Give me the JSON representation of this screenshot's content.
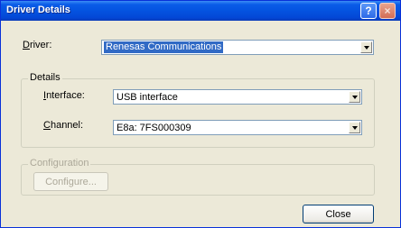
{
  "window": {
    "title": "Driver Details"
  },
  "titlebar_buttons": {
    "help": "?",
    "close": "×"
  },
  "driver": {
    "label_accel": "D",
    "label_rest": "river:",
    "value": "Renesas Communications"
  },
  "details": {
    "legend": "Details",
    "interface": {
      "label_accel": "I",
      "label_rest": "nterface:",
      "value": "USB interface"
    },
    "channel": {
      "label_accel": "C",
      "label_rest": "hannel:",
      "value": "E8a: 7FS000309"
    }
  },
  "configuration": {
    "legend": "Configuration",
    "button": "Configure..."
  },
  "footer": {
    "close_button": "Close"
  }
}
